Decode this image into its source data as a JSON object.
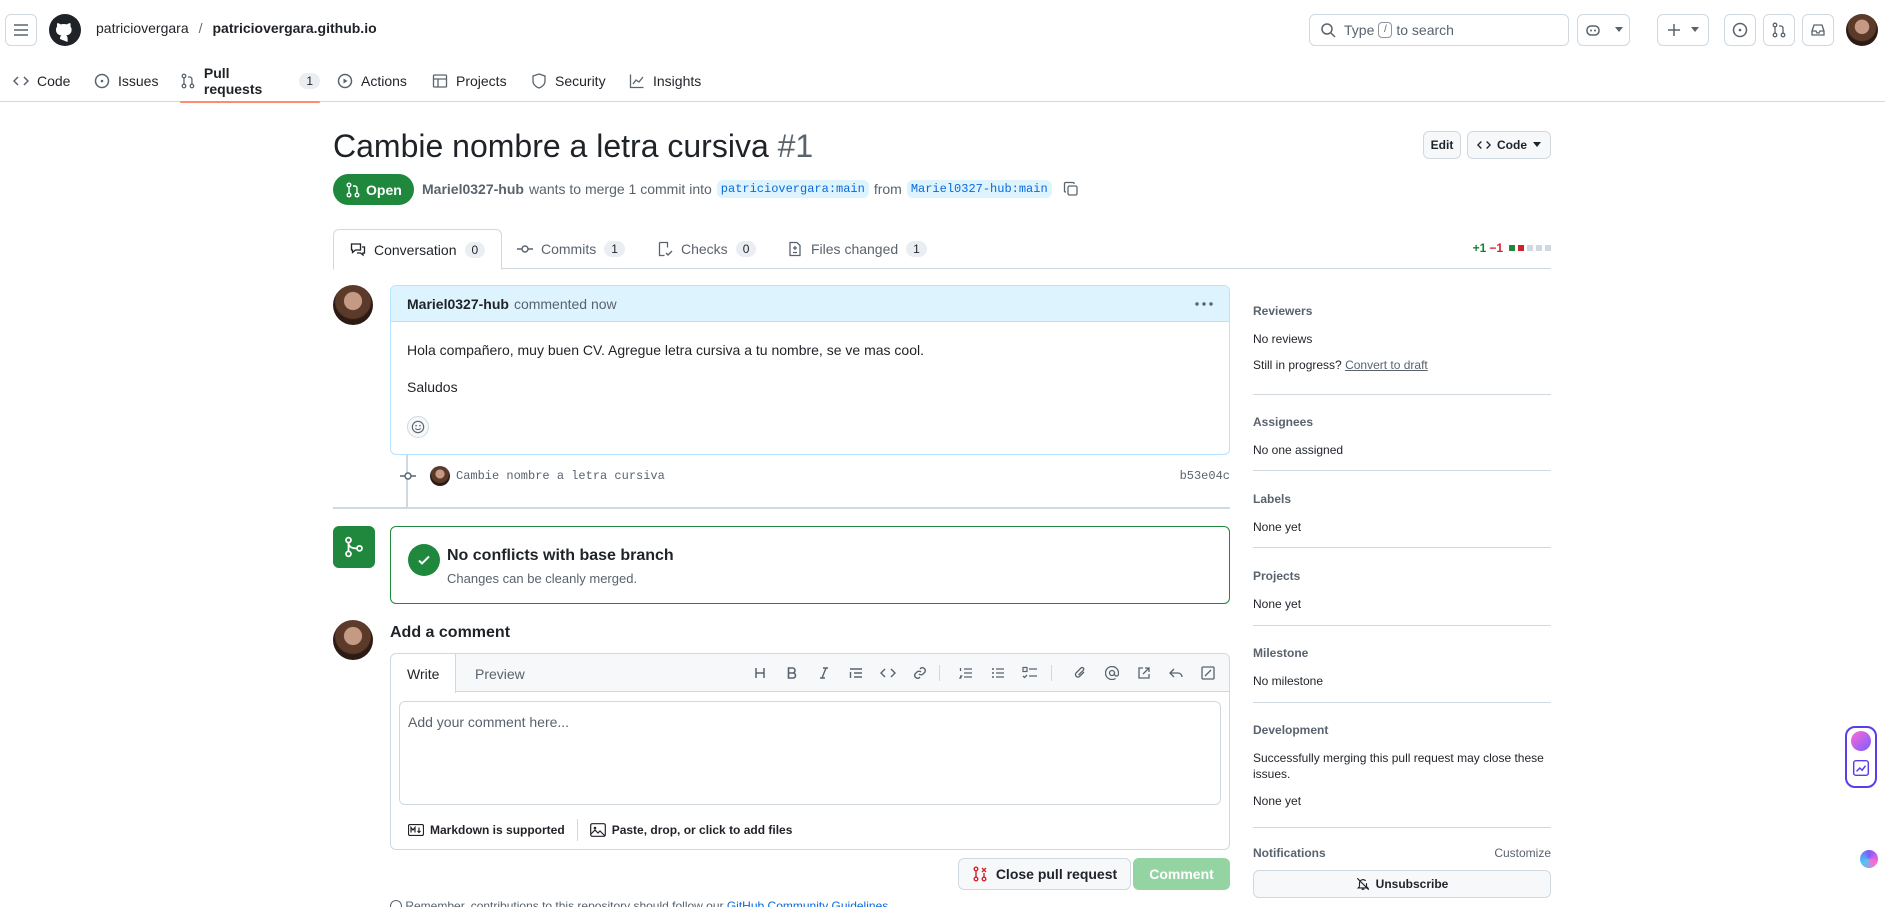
{
  "header": {
    "owner": "patriciovergara",
    "separator": "/",
    "repo": "patriciovergara.github.io",
    "search_prefix": "Type",
    "search_key": "/",
    "search_suffix": "to search"
  },
  "repo_nav": [
    {
      "label": "Code",
      "icon": "code-icon"
    },
    {
      "label": "Issues",
      "icon": "issue-icon"
    },
    {
      "label": "Pull requests",
      "icon": "pull-request-icon",
      "count": "1",
      "active": true
    },
    {
      "label": "Actions",
      "icon": "play-icon"
    },
    {
      "label": "Projects",
      "icon": "table-icon"
    },
    {
      "label": "Security",
      "icon": "shield-icon"
    },
    {
      "label": "Insights",
      "icon": "graph-icon"
    }
  ],
  "pr": {
    "title": "Cambie nombre a letra cursiva",
    "number": "#1",
    "edit_label": "Edit",
    "code_label": "Code",
    "state": "Open",
    "author": "Mariel0327-hub",
    "merge_text": "wants to merge 1 commit into",
    "base_branch": "patriciovergara:main",
    "from_text": "from",
    "head_branch": "Mariel0327-hub:main"
  },
  "tabs": [
    {
      "label": "Conversation",
      "count": "0",
      "icon": "comment-discussion-icon"
    },
    {
      "label": "Commits",
      "count": "1",
      "icon": "commit-icon"
    },
    {
      "label": "Checks",
      "count": "0",
      "icon": "checklist-icon"
    },
    {
      "label": "Files changed",
      "count": "1",
      "icon": "file-diff-icon"
    }
  ],
  "diffstat": {
    "additions": "+1",
    "deletions": "−1"
  },
  "comment": {
    "author": "Mariel0327-hub",
    "time": "commented now",
    "body_line1": "Hola compañero, muy buen CV. Agregue letra cursiva a tu nombre, se ve mas cool.",
    "body_line2": "Saludos"
  },
  "commit": {
    "message": "Cambie nombre a letra cursiva",
    "sha": "b53e04c"
  },
  "merge": {
    "title": "No conflicts with base branch",
    "subtitle": "Changes can be cleanly merged."
  },
  "add_comment": {
    "title": "Add a comment",
    "write_tab": "Write",
    "preview_tab": "Preview",
    "placeholder": "Add your comment here...",
    "markdown_note": "Markdown is supported",
    "attach_note": "Paste, drop, or click to add files",
    "close_button": "Close pull request",
    "comment_button": "Comment",
    "footnote_prefix": "Remember, contributions to this repository should follow our",
    "footnote_link": "GitHub Community Guidelines"
  },
  "sidebar": {
    "reviewers": {
      "heading": "Reviewers",
      "value": "No reviews",
      "progress_q": "Still in progress?",
      "draft_link": "Convert to draft"
    },
    "assignees": {
      "heading": "Assignees",
      "value": "No one assigned"
    },
    "labels": {
      "heading": "Labels",
      "value": "None yet"
    },
    "projects": {
      "heading": "Projects",
      "value": "None yet"
    },
    "milestone": {
      "heading": "Milestone",
      "value": "No milestone"
    },
    "development": {
      "heading": "Development",
      "desc": "Successfully merging this pull request may close these issues.",
      "value": "None yet"
    },
    "notifications": {
      "heading": "Notifications",
      "customize": "Customize",
      "unsubscribe": "Unsubscribe"
    }
  },
  "colors": {
    "accent": "#1f883d",
    "link": "#0969da",
    "nav_underline": "#fd8c73"
  }
}
